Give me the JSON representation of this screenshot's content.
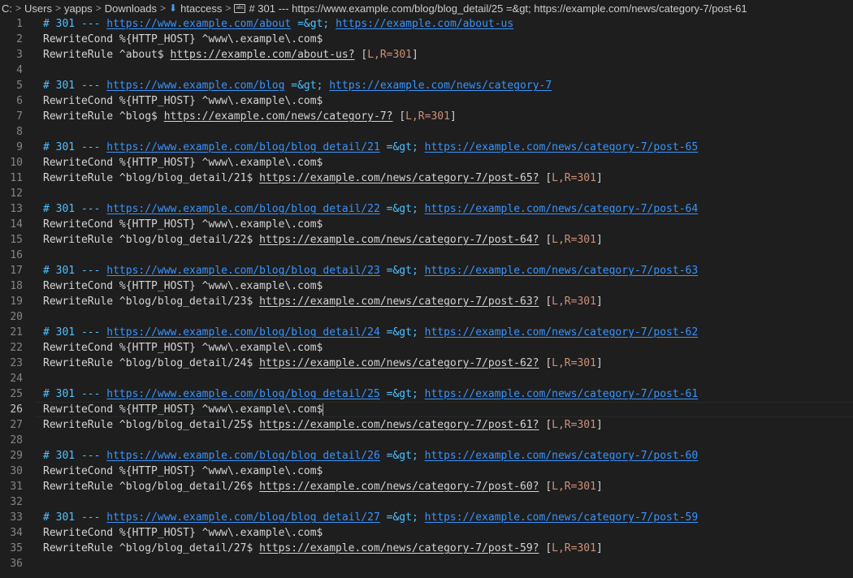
{
  "breadcrumb": {
    "drive": "C:",
    "parts": [
      "Users",
      "yapps",
      "Downloads"
    ],
    "file": "htaccess",
    "symbol": "# 301 --- https://www.example.com/blog/blog_detail/25 =&gt; https://example.com/news/category-7/post-61"
  },
  "cursor_line": 26,
  "lines": [
    {
      "n": "1",
      "type": "comment",
      "c_prefix": "# 301 --- ",
      "from": "https://www.example.com/about",
      "arrow": " =&gt; ",
      "to": "https://example.com/about-us"
    },
    {
      "n": "2",
      "type": "cond",
      "text": "RewriteCond %{HTTP_HOST} ^www\\.example\\.com$"
    },
    {
      "n": "3",
      "type": "rule",
      "prefix": "RewriteRule ^about$ ",
      "url": "https://example.com/about-us?",
      "flags": "L,R=301"
    },
    {
      "n": "4",
      "type": "blank"
    },
    {
      "n": "5",
      "type": "comment",
      "c_prefix": "# 301 --- ",
      "from": "https://www.example.com/blog",
      "arrow": " =&gt; ",
      "to": "https://example.com/news/category-7"
    },
    {
      "n": "6",
      "type": "cond",
      "text": "RewriteCond %{HTTP_HOST} ^www\\.example\\.com$"
    },
    {
      "n": "7",
      "type": "rule",
      "prefix": "RewriteRule ^blog$ ",
      "url": "https://example.com/news/category-7?",
      "flags": "L,R=301"
    },
    {
      "n": "8",
      "type": "blank"
    },
    {
      "n": "9",
      "type": "comment",
      "c_prefix": "# 301 --- ",
      "from": "https://www.example.com/blog/blog_detail/21",
      "arrow": " =&gt; ",
      "to": "https://example.com/news/category-7/post-65"
    },
    {
      "n": "10",
      "type": "cond",
      "text": "RewriteCond %{HTTP_HOST} ^www\\.example\\.com$"
    },
    {
      "n": "11",
      "type": "rule",
      "prefix": "RewriteRule ^blog/blog_detail/21$ ",
      "url": "https://example.com/news/category-7/post-65?",
      "flags": "L,R=301"
    },
    {
      "n": "12",
      "type": "blank"
    },
    {
      "n": "13",
      "type": "comment",
      "c_prefix": "# 301 --- ",
      "from": "https://www.example.com/blog/blog_detail/22",
      "arrow": " =&gt; ",
      "to": "https://example.com/news/category-7/post-64"
    },
    {
      "n": "14",
      "type": "cond",
      "text": "RewriteCond %{HTTP_HOST} ^www\\.example\\.com$"
    },
    {
      "n": "15",
      "type": "rule",
      "prefix": "RewriteRule ^blog/blog_detail/22$ ",
      "url": "https://example.com/news/category-7/post-64?",
      "flags": "L,R=301"
    },
    {
      "n": "16",
      "type": "blank"
    },
    {
      "n": "17",
      "type": "comment",
      "c_prefix": "# 301 --- ",
      "from": "https://www.example.com/blog/blog_detail/23",
      "arrow": " =&gt; ",
      "to": "https://example.com/news/category-7/post-63"
    },
    {
      "n": "18",
      "type": "cond",
      "text": "RewriteCond %{HTTP_HOST} ^www\\.example\\.com$"
    },
    {
      "n": "19",
      "type": "rule",
      "prefix": "RewriteRule ^blog/blog_detail/23$ ",
      "url": "https://example.com/news/category-7/post-63?",
      "flags": "L,R=301"
    },
    {
      "n": "20",
      "type": "blank"
    },
    {
      "n": "21",
      "type": "comment",
      "c_prefix": "# 301 --- ",
      "from": "https://www.example.com/blog/blog_detail/24",
      "arrow": " =&gt; ",
      "to": "https://example.com/news/category-7/post-62"
    },
    {
      "n": "22",
      "type": "cond",
      "text": "RewriteCond %{HTTP_HOST} ^www\\.example\\.com$"
    },
    {
      "n": "23",
      "type": "rule",
      "prefix": "RewriteRule ^blog/blog_detail/24$ ",
      "url": "https://example.com/news/category-7/post-62?",
      "flags": "L,R=301"
    },
    {
      "n": "24",
      "type": "blank"
    },
    {
      "n": "25",
      "type": "comment",
      "c_prefix": "# 301 --- ",
      "from": "https://www.example.com/blog/blog_detail/25",
      "arrow": " =&gt; ",
      "to": "https://example.com/news/category-7/post-61"
    },
    {
      "n": "26",
      "type": "cond",
      "text": "RewriteCond %{HTTP_HOST} ^www\\.example\\.com$"
    },
    {
      "n": "27",
      "type": "rule",
      "prefix": "RewriteRule ^blog/blog_detail/25$ ",
      "url": "https://example.com/news/category-7/post-61?",
      "flags": "L,R=301"
    },
    {
      "n": "28",
      "type": "blank"
    },
    {
      "n": "29",
      "type": "comment",
      "c_prefix": "# 301 --- ",
      "from": "https://www.example.com/blog/blog_detail/26",
      "arrow": " =&gt; ",
      "to": "https://example.com/news/category-7/post-60"
    },
    {
      "n": "30",
      "type": "cond",
      "text": "RewriteCond %{HTTP_HOST} ^www\\.example\\.com$"
    },
    {
      "n": "31",
      "type": "rule",
      "prefix": "RewriteRule ^blog/blog_detail/26$ ",
      "url": "https://example.com/news/category-7/post-60?",
      "flags": "L,R=301"
    },
    {
      "n": "32",
      "type": "blank"
    },
    {
      "n": "33",
      "type": "comment",
      "c_prefix": "# 301 --- ",
      "from": "https://www.example.com/blog/blog_detail/27",
      "arrow": " =&gt; ",
      "to": "https://example.com/news/category-7/post-59"
    },
    {
      "n": "34",
      "type": "cond",
      "text": "RewriteCond %{HTTP_HOST} ^www\\.example\\.com$"
    },
    {
      "n": "35",
      "type": "rule",
      "prefix": "RewriteRule ^blog/blog_detail/27$ ",
      "url": "https://example.com/news/category-7/post-59?",
      "flags": "L,R=301"
    },
    {
      "n": "36",
      "type": "blank"
    }
  ]
}
